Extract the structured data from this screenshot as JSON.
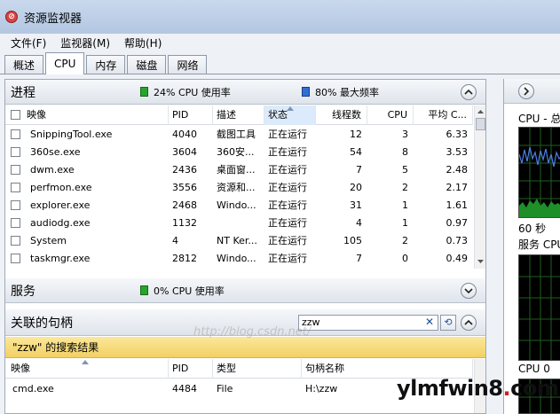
{
  "window": {
    "title": "资源监视器"
  },
  "menu": [
    "文件(F)",
    "监视器(M)",
    "帮助(H)"
  ],
  "tabs": [
    {
      "label": "概述",
      "active": false
    },
    {
      "label": "CPU",
      "active": true
    },
    {
      "label": "内存",
      "active": false
    },
    {
      "label": "磁盘",
      "active": false
    },
    {
      "label": "网络",
      "active": false
    }
  ],
  "processes": {
    "title": "进程",
    "cpu_usage_label": "24% CPU 使用率",
    "max_freq_label": "80% 最大频率",
    "columns": [
      "映像",
      "PID",
      "描述",
      "状态",
      "线程数",
      "CPU",
      "平均 C..."
    ],
    "rows": [
      {
        "image": "SnippingTool.exe",
        "pid": "4040",
        "desc": "截图工具",
        "status": "正在运行",
        "threads": "12",
        "cpu": "3",
        "avg": "6.33"
      },
      {
        "image": "360se.exe",
        "pid": "3604",
        "desc": "360安...",
        "status": "正在运行",
        "threads": "54",
        "cpu": "8",
        "avg": "3.53"
      },
      {
        "image": "dwm.exe",
        "pid": "2436",
        "desc": "桌面窗...",
        "status": "正在运行",
        "threads": "7",
        "cpu": "5",
        "avg": "2.48"
      },
      {
        "image": "perfmon.exe",
        "pid": "3556",
        "desc": "资源和...",
        "status": "正在运行",
        "threads": "20",
        "cpu": "2",
        "avg": "2.17"
      },
      {
        "image": "explorer.exe",
        "pid": "2468",
        "desc": "Windo...",
        "status": "正在运行",
        "threads": "31",
        "cpu": "1",
        "avg": "1.61"
      },
      {
        "image": "audiodg.exe",
        "pid": "1132",
        "desc": "",
        "status": "正在运行",
        "threads": "4",
        "cpu": "1",
        "avg": "0.97"
      },
      {
        "image": "System",
        "pid": "4",
        "desc": "NT Ker...",
        "status": "正在运行",
        "threads": "105",
        "cpu": "2",
        "avg": "0.73"
      },
      {
        "image": "taskmgr.exe",
        "pid": "2812",
        "desc": "Windo...",
        "status": "正在运行",
        "threads": "7",
        "cpu": "0",
        "avg": "0.49"
      }
    ]
  },
  "services": {
    "title": "服务",
    "cpu_usage_label": "0% CPU 使用率"
  },
  "handles": {
    "title": "关联的句柄",
    "search_value": "zzw",
    "clear_glyph": "✕",
    "go_glyph": "⟲",
    "result_label": "\"zzw\" 的搜索结果",
    "columns": [
      "映像",
      "PID",
      "类型",
      "句柄名称"
    ],
    "rows": [
      {
        "image": "cmd.exe",
        "pid": "4484",
        "type": "File",
        "name": "H:\\zzw"
      }
    ]
  },
  "right_panel": {
    "cpu_label": "CPU - 总",
    "seconds_label": "60 秒",
    "service_label": "服务 CPU",
    "cpu0_label": "CPU 0"
  },
  "watermarks": {
    "url": "http://blog.csdn.net/",
    "logo_main": "ylmfwin8",
    "logo_dot": ".",
    "logo_tail": "com"
  },
  "colors": {
    "cpu_legend": "#27a52b",
    "freq_legend": "#2f6fd6",
    "result_bar": "#f2d063",
    "graph_bg": "#000000"
  }
}
